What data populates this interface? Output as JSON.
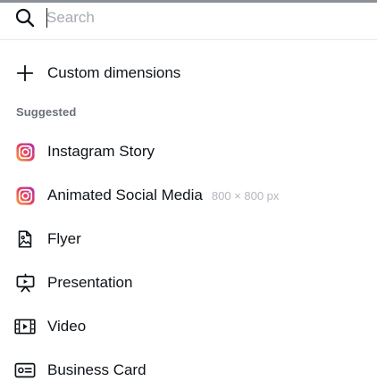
{
  "search": {
    "placeholder": "Search",
    "value": ""
  },
  "custom": {
    "label": "Custom dimensions"
  },
  "suggested": {
    "heading": "Suggested",
    "items": [
      {
        "label": "Instagram Story",
        "dimensions": "",
        "icon": "instagram-icon"
      },
      {
        "label": "Animated Social Media",
        "dimensions": "800 × 800 px",
        "icon": "instagram-icon"
      },
      {
        "label": "Flyer",
        "dimensions": "",
        "icon": "flyer-icon"
      },
      {
        "label": "Presentation",
        "dimensions": "",
        "icon": "presentation-icon"
      },
      {
        "label": "Video",
        "dimensions": "",
        "icon": "video-icon"
      },
      {
        "label": "Business Card",
        "dimensions": "",
        "icon": "business-card-icon"
      }
    ]
  },
  "colors": {
    "instagram_gradient": [
      "#f9a43a",
      "#e4405f",
      "#a033b8"
    ],
    "text": "#0e1318",
    "muted": "#6a7079",
    "placeholder": "#a7abb1"
  }
}
